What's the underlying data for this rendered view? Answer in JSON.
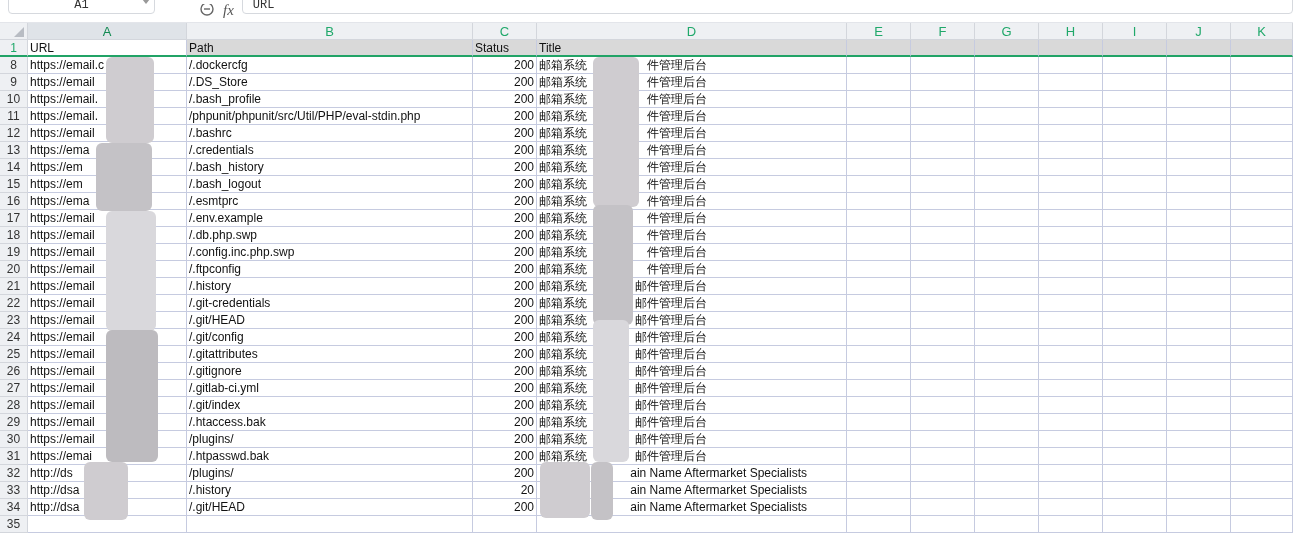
{
  "formula_bar": {
    "cell_ref": "A1",
    "fx_label": "fx",
    "formula": "URL"
  },
  "columns": [
    {
      "label": "A",
      "selected": true
    },
    {
      "label": "B",
      "selected": false
    },
    {
      "label": "C",
      "selected": false
    },
    {
      "label": "D",
      "selected": false
    },
    {
      "label": "E",
      "selected": false
    },
    {
      "label": "F",
      "selected": false
    },
    {
      "label": "G",
      "selected": false
    },
    {
      "label": "H",
      "selected": false
    },
    {
      "label": "I",
      "selected": false
    },
    {
      "label": "J",
      "selected": false
    },
    {
      "label": "K",
      "selected": false
    }
  ],
  "header_row": {
    "number": "1",
    "cells": [
      "URL",
      "Path",
      "Status",
      "Title"
    ]
  },
  "rows": [
    {
      "number": "8",
      "url": "https://email.c",
      "path": "/.dockercfg",
      "status": "200",
      "title_start": "邮箱系统",
      "title_end": "件管理后台"
    },
    {
      "number": "9",
      "url": "https://email",
      "path": "/.DS_Store",
      "status": "200",
      "title_start": "邮箱系统",
      "title_end": "件管理后台"
    },
    {
      "number": "10",
      "url": "https://email.",
      "path": "/.bash_profile",
      "status": "200",
      "title_start": "邮箱系统",
      "title_end": "件管理后台"
    },
    {
      "number": "11",
      "url": "https://email.",
      "path": "/phpunit/phpunit/src/Util/PHP/eval-stdin.php",
      "status": "200",
      "title_start": "邮箱系统",
      "title_end": "件管理后台"
    },
    {
      "number": "12",
      "url": "https://email",
      "path": "/.bashrc",
      "status": "200",
      "title_start": "邮箱系统",
      "title_end": "件管理后台"
    },
    {
      "number": "13",
      "url": "https://ema",
      "path": "/.credentials",
      "status": "200",
      "title_start": "邮箱系统",
      "title_end": "件管理后台"
    },
    {
      "number": "14",
      "url": "https://em",
      "path": "/.bash_history",
      "status": "200",
      "title_start": "邮箱系统",
      "title_end": "件管理后台"
    },
    {
      "number": "15",
      "url": "https://em",
      "path": "/.bash_logout",
      "status": "200",
      "title_start": "邮箱系统",
      "title_end": "件管理后台"
    },
    {
      "number": "16",
      "url": "https://ema",
      "path": "/.esmtprc",
      "status": "200",
      "title_start": "邮箱系统",
      "title_end": "件管理后台"
    },
    {
      "number": "17",
      "url": "https://email",
      "path": "/.env.example",
      "status": "200",
      "title_start": "邮箱系统",
      "title_end": "件管理后台"
    },
    {
      "number": "18",
      "url": "https://email",
      "path": "/.db.php.swp",
      "status": "200",
      "title_start": "邮箱系统",
      "title_end": "件管理后台"
    },
    {
      "number": "19",
      "url": "https://email",
      "path": "/.config.inc.php.swp",
      "status": "200",
      "title_start": "邮箱系统",
      "title_end": "件管理后台"
    },
    {
      "number": "20",
      "url": "https://email",
      "path": "/.ftpconfig",
      "status": "200",
      "title_start": "邮箱系统",
      "title_end": "件管理后台"
    },
    {
      "number": "21",
      "url": "https://email",
      "path": "/.history",
      "status": "200",
      "title_start": "邮箱系统",
      "title_end": "邮件管理后台"
    },
    {
      "number": "22",
      "url": "https://email",
      "path": "/.git-credentials",
      "status": "200",
      "title_start": "邮箱系统",
      "title_end": "邮件管理后台"
    },
    {
      "number": "23",
      "url": "https://email",
      "path": "/.git/HEAD",
      "status": "200",
      "title_start": "邮箱系统",
      "title_end": "邮件管理后台"
    },
    {
      "number": "24",
      "url": "https://email",
      "path": "/.git/config",
      "status": "200",
      "title_start": "邮箱系统",
      "title_end": "邮件管理后台"
    },
    {
      "number": "25",
      "url": "https://email",
      "path": "/.gitattributes",
      "status": "200",
      "title_start": "邮箱系统",
      "title_end": "邮件管理后台"
    },
    {
      "number": "26",
      "url": "https://email",
      "path": "/.gitignore",
      "status": "200",
      "title_start": "邮箱系统",
      "title_end": "邮件管理后台"
    },
    {
      "number": "27",
      "url": "https://email",
      "path": "/.gitlab-ci.yml",
      "status": "200",
      "title_start": "邮箱系统",
      "title_end": "邮件管理后台"
    },
    {
      "number": "28",
      "url": "https://email",
      "path": "/.git/index",
      "status": "200",
      "title_start": "邮箱系统",
      "title_end": "邮件管理后台"
    },
    {
      "number": "29",
      "url": "https://email",
      "path": "/.htaccess.bak",
      "status": "200",
      "title_start": "邮箱系统",
      "title_end": "邮件管理后台"
    },
    {
      "number": "30",
      "url": "https://email",
      "path": "/plugins/",
      "status": "200",
      "title_start": "邮箱系统",
      "title_end": "邮件管理后台"
    },
    {
      "number": "31",
      "url": "https://emai",
      "path": "/.htpasswd.bak",
      "status": "200",
      "title_start": "邮箱系统",
      "title_end": "邮件管理后台"
    },
    {
      "number": "32",
      "url": "http://ds",
      "path": "/plugins/",
      "status": "200",
      "title_end": "ain Name Aftermarket Specialists"
    },
    {
      "number": "33",
      "url": "http://dsa",
      "path": "/.history",
      "status": "20",
      "title_end": "ain Name Aftermarket Specialists"
    },
    {
      "number": "34",
      "url": "http://dsa",
      "path": "/.git/HEAD",
      "status": "200",
      "title_end": "ain Name Aftermarket Specialists"
    },
    {
      "number": "35"
    }
  ]
}
